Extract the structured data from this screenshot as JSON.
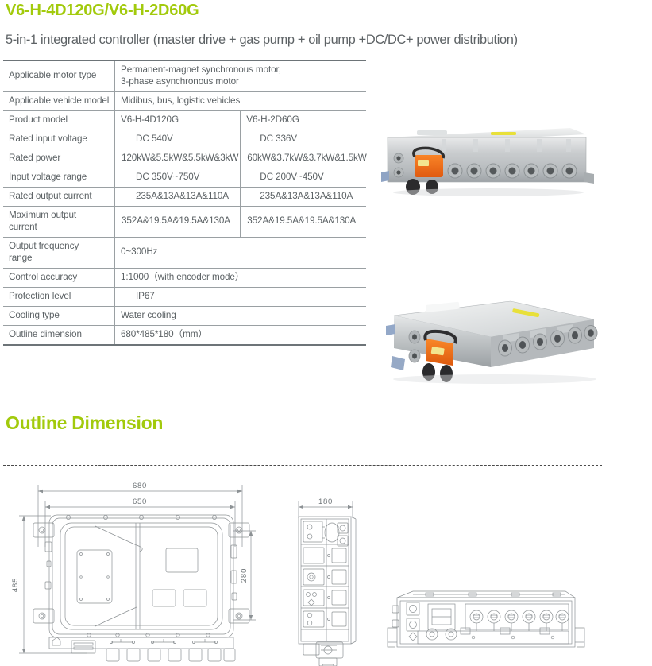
{
  "header": {
    "title": "V6-H-4D120G/V6-H-2D60G",
    "subtitle": "5-in-1 integrated controller (master drive + gas pump + oil pump +DC/DC+ power distribution)",
    "accent_color": "#a2ca0c"
  },
  "spec_table": {
    "rows": [
      {
        "label": "Applicable motor type",
        "value": "Permanent-magnet synchronous motor,\n3-phase asynchronous motor",
        "span": true
      },
      {
        "label": "Applicable vehicle model",
        "value": "Midibus, bus, logistic vehicles",
        "span": true
      },
      {
        "label": "Product model",
        "value_a": "V6-H-4D120G",
        "value_b": "V6-H-2D60G",
        "span": false
      },
      {
        "label": "Rated input voltage",
        "value_a": "DC    540V",
        "value_b": "DC    336V",
        "span": false
      },
      {
        "label": "Rated power",
        "value_a": "120kW&5.5kW&5.5kW&3kW",
        "value_b": "60kW&3.7kW&3.7kW&1.5kW",
        "span": false
      },
      {
        "label": "Input voltage range",
        "value_a": "DC    350V~750V",
        "value_b": "DC    200V~450V",
        "span": false
      },
      {
        "label": "Rated output current",
        "value_a": "235A&13A&13A&110A",
        "value_b": "235A&13A&13A&110A",
        "span": false
      },
      {
        "label": "Maximum output current",
        "value_a": "352A&19.5A&19.5A&130A",
        "value_b": "352A&19.5A&19.5A&130A",
        "span": false
      },
      {
        "label": "Output frequency range",
        "value": "0~300Hz",
        "span": true
      },
      {
        "label": "Control accuracy",
        "value": "1:1000（with encoder mode）",
        "span": true
      },
      {
        "label": "Protection level",
        "value": "IP67",
        "span": true
      },
      {
        "label": "Cooling type",
        "value": "Water cooling",
        "span": true
      },
      {
        "label": "Outline dimension",
        "value": "680*485*180（mm）",
        "span": true
      }
    ]
  },
  "photos": [
    {
      "name": "controller-photo-front",
      "alt": "5-in-1 integrated controller front view"
    },
    {
      "name": "controller-photo-angled",
      "alt": "5-in-1 integrated controller angled view"
    }
  ],
  "outline_section": {
    "heading": "Outline Dimension",
    "drawings": {
      "top_view": {
        "dim_overall_width": "680",
        "dim_inner_width": "650",
        "dim_height": "485",
        "dim_inner_height": "280"
      },
      "side_view": {
        "dim_depth": "180"
      },
      "front_view": {
        "label": ""
      }
    }
  }
}
